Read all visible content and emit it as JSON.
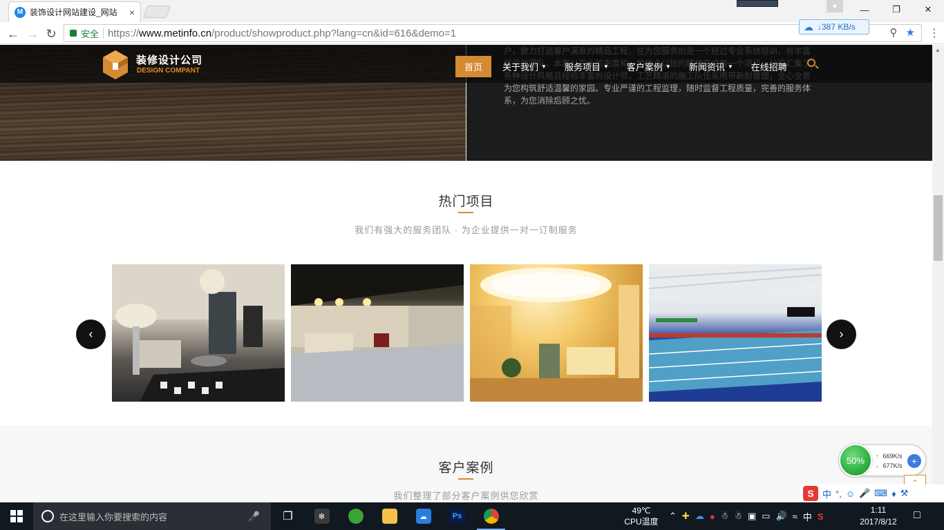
{
  "browser": {
    "tab_title": "装饰设计网站建设_网站",
    "tab_favicon_letter": "M",
    "url_secure_label": "安全",
    "url_prefix": "https://",
    "url_host": "www.metinfo.cn",
    "url_path": "/product/showproduct.php?lang=cn&id=616&demo=1",
    "download_speed": "387 KB/s"
  },
  "site": {
    "logo_cn": "装修设计公司",
    "logo_en": "DESIGN COMPANT",
    "brand_color": "#d58b32",
    "nav": [
      {
        "label": "首页"
      },
      {
        "label": "关于我们"
      },
      {
        "label": "服务项目"
      },
      {
        "label": "客户案例"
      },
      {
        "label": "新闻资讯"
      },
      {
        "label": "在线招聘"
      }
    ],
    "hero_text": "户，致力打造客户满意的精品工程，在为您服务的是一个经过专业系统培训，有丰富经验的团队，本着以专业的态度和一种持之以恒的精神完成每一个项目。公司汇集了各种设计风格且经验丰富的设计师，工艺精湛的施工队伍采用带新耐管理，全心全意为您构筑舒适温馨的家园。专业严谨的工程监理，随时监督工程质量，完善的服务体系，为您消除后顾之忧。"
  },
  "hot": {
    "title": "热门项目",
    "subtitle": "我们有强大的服务团队 · 为企业提供一对一订制服务",
    "slides": [
      "living-room",
      "lobby",
      "hotel-reception",
      "swimming-pool"
    ]
  },
  "cases": {
    "title": "客户案例",
    "subtitle": "我们整理了部分客户案例供您欣赏"
  },
  "net_widget": {
    "percent": "50%",
    "up": "669K/s",
    "down": "677K/s"
  },
  "ime": {
    "mode": "中"
  },
  "taskbar": {
    "search_placeholder": "在这里输入你要搜索的内容",
    "cpu_temp": "49℃",
    "cpu_label": "CPU温度",
    "lang": "中",
    "time": "1:11",
    "date": "2017/8/12"
  }
}
